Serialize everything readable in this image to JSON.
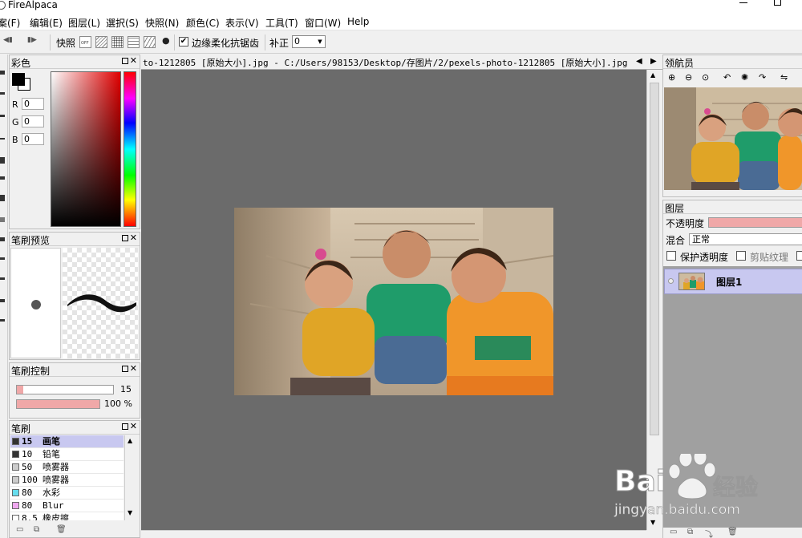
{
  "window": {
    "title": "FireAlpaca"
  },
  "menu": [
    "案(F)",
    "编辑(E)",
    "图层(L)",
    "選択(S)",
    "快照(N)",
    "颜色(C)",
    "表示(V)",
    "工具(T)",
    "窗口(W)",
    "Help"
  ],
  "toolbar": {
    "snap_label": "快照",
    "snap_off": "OFF",
    "antialias_check": "✔",
    "antialias_label": "边缘柔化抗锯齿",
    "correction_label": "补正",
    "correction_value": "0"
  },
  "color_panel": {
    "title": "彩色",
    "r_label": "R",
    "r_value": "0",
    "g_label": "G",
    "g_value": "0",
    "b_label": "B",
    "b_value": "0"
  },
  "brush_preview": {
    "title": "笔刷预览"
  },
  "brush_control": {
    "title": "笔刷控制",
    "size_value": "15",
    "size_fraction": 0.07,
    "opacity_value": "100 %",
    "opacity_fraction": 1.0
  },
  "brush_panel": {
    "title": "笔刷",
    "items": [
      {
        "size": "15",
        "name": "画笔",
        "color": "#333333",
        "selected": true
      },
      {
        "size": "10",
        "name": "铅笔",
        "color": "#333333"
      },
      {
        "size": "50",
        "name": "喷雾器",
        "color": "#cccccc"
      },
      {
        "size": "100",
        "name": "喷雾器",
        "color": "#cccccc"
      },
      {
        "size": "80",
        "name": "水彩",
        "color": "#66ddee"
      },
      {
        "size": "80",
        "name": "Blur",
        "color": "#f0a8f0"
      },
      {
        "size": "8.5",
        "name": "橡皮擦",
        "color": "#ffffff"
      }
    ]
  },
  "document": {
    "tab_title": "to-1212805 [原始大小].jpg - C:/Users/98153/Desktop/存图片/2/pexels-photo-1212805 [原始大小].jpg"
  },
  "navigator": {
    "title": "领航员"
  },
  "layer_panel": {
    "title": "图层",
    "opacity_label": "不透明度",
    "blend_label": "混合",
    "blend_value": "正常",
    "protect_alpha_label": "保护透明度",
    "clipping_label": "剪贴纹理",
    "layer_name": "图层1"
  },
  "watermark": {
    "logo_text_left": "Bai",
    "logo_text_right": "经验",
    "url": "jingyan.baidu.com"
  },
  "colors": {
    "accent_pink": "#f0a8a8",
    "selection_lavender": "#c8c8f0",
    "canvas_gray": "#6b6b6b"
  }
}
